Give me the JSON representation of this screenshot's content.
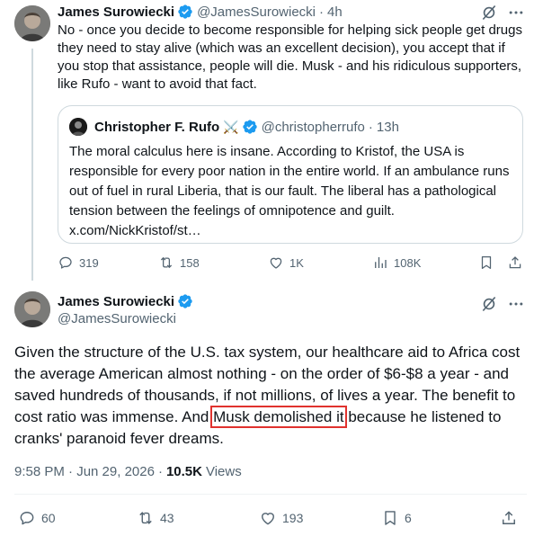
{
  "reply_tweet": {
    "author_name": "James Surowiecki",
    "author_handle": "@JamesSurowiecki",
    "separator": "·",
    "time": "4h",
    "body": "No - once you decide to become responsible for helping sick people get drugs they need to stay alive (which was an excellent decision), you accept that if you stop that assistance, people will die. Musk - and his ridiculous supporters, like Rufo - want to avoid that fact.",
    "quote": {
      "author_name": "Christopher F. Rufo",
      "emoji": "⚔️",
      "author_handle": "@christopherrufo",
      "separator": "·",
      "time": "13h",
      "body": "The moral calculus here is insane. According to Kristof, the USA is responsible for every poor nation in the entire world. If an ambulance runs out of fuel in rural Liberia, that is our fault. The liberal has a pathological tension between the feelings of omnipotence and guilt. x.com/NickKristof/st…"
    },
    "stats": {
      "replies": "319",
      "reposts": "158",
      "likes": "1K",
      "views": "108K"
    }
  },
  "main_tweet": {
    "author_name": "James Surowiecki",
    "author_handle": "@JamesSurowiecki",
    "body_before": "Given the structure of the U.S. tax system, our healthcare aid to Africa cost the average American almost nothing - on the order of $6-$8 a year - and saved hundreds of thousands, if not millions, of lives a year. The benefit to cost ratio was immense. And ",
    "body_highlight": "Musk demolished it",
    "body_after": " because he listened to cranks' paranoid fever dreams.",
    "timestamp": "9:58 PM · Jun 29, 2026",
    "meta_separator": "·",
    "views_count": "10.5K",
    "views_label": "Views",
    "stats": {
      "replies": "60",
      "reposts": "43",
      "likes": "193",
      "bookmarks": "6"
    }
  },
  "colors": {
    "text": "#0f1419",
    "secondary": "#536471",
    "verified_blue": "#1d9bf0",
    "highlight_box": "#e0322e",
    "border": "#cfd9de"
  }
}
